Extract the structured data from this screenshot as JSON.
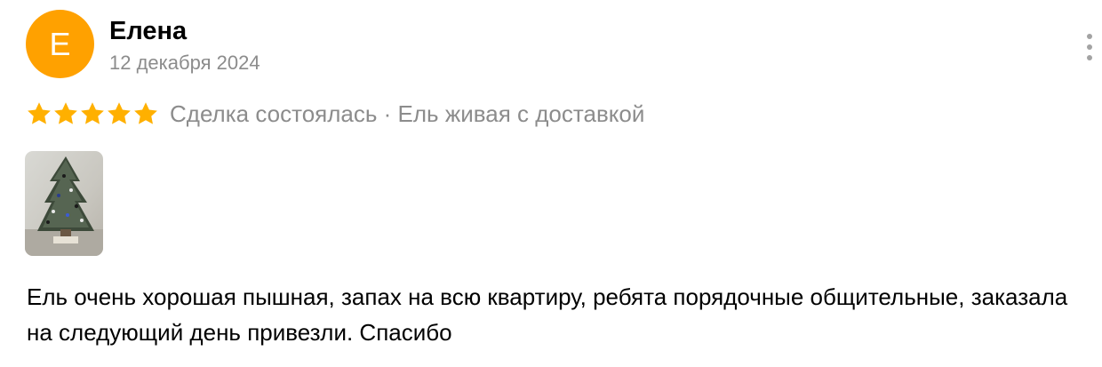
{
  "review": {
    "author": {
      "initial": "Е",
      "name": "Елена",
      "avatar_color": "#ffa100"
    },
    "date": "12 декабря 2024",
    "rating": 5,
    "rating_max": 5,
    "star_color": "#ffb000",
    "meta": "Сделка состоялась · Ель живая с доставкой",
    "photos": [
      {
        "icon": "photo-thumbnail-christmas-tree"
      }
    ],
    "text": "Ель очень хорошая пышная, запах на всю квартиру, ребята порядочные общительные, заказала на следующий день привезли. Спасибо",
    "more_menu_icon": "more-vertical-icon"
  }
}
